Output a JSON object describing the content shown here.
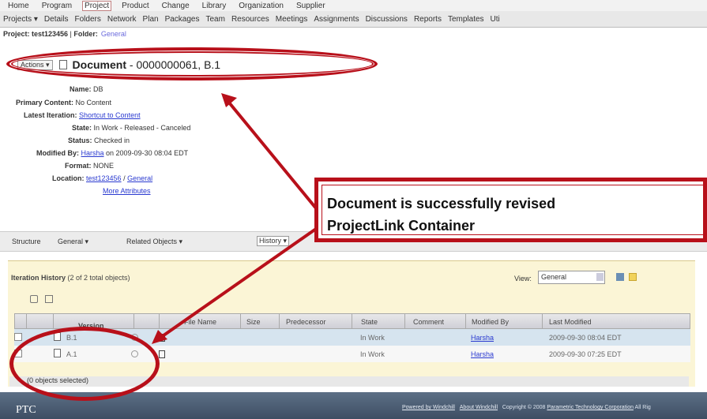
{
  "nav_top": [
    "Home",
    "Program",
    "Project",
    "Product",
    "Change",
    "Library",
    "Organization",
    "Supplier"
  ],
  "nav_top_active": "Project",
  "nav_sub": [
    "Projects ▾",
    "Details",
    "Folders",
    "Network",
    "Plan",
    "Packages",
    "Team",
    "Resources",
    "Meetings",
    "Assignments",
    "Discussions",
    "Reports",
    "Templates",
    "Uti"
  ],
  "breadcrumb": {
    "project": "Project: test123456",
    "sep": " | ",
    "folder_label": "Folder:",
    "folder": "General"
  },
  "header": {
    "actions": "Actions ▾",
    "doc_type": "Document",
    "doc_rest": " - 0000000061, B.1"
  },
  "attributes": {
    "name_label": "Name:",
    "name_value": "DB",
    "primary_label": "Primary Content:",
    "primary_value": "No Content",
    "latest_label": "Latest Iteration:",
    "latest_value": "Shortcut to Content",
    "state_label": "State:",
    "state_value": "In Work - Released - Canceled",
    "status_label": "Status:",
    "status_value": "Checked in",
    "modified_label": "Modified By:",
    "modified_user": "Harsha",
    "modified_rest": " on 2009-09-30 08:04 EDT",
    "format_label": "Format:",
    "format_value": "NONE",
    "location_label": "Location:",
    "location_project": "test123456",
    "location_sep": " / ",
    "location_folder": "General",
    "more": "More Attributes"
  },
  "tabs": [
    "Structure",
    "General ▾",
    "Related Objects ▾"
  ],
  "history_tab": "History ▾",
  "iteration": {
    "title": "Iteration History",
    "count": " (2 of 2 total objects)",
    "view_label": "View:",
    "view_value": "General"
  },
  "table": {
    "columns": [
      "Version",
      "",
      "File Name",
      "Size",
      "Predecessor",
      "State",
      "Comment",
      "Modified By",
      "Last Modified"
    ],
    "sort_indicator": "↓",
    "rows": [
      {
        "version": "B.1",
        "state": "In Work",
        "modified_by": "Harsha",
        "last_modified": "2009-09-30 08:04 EDT"
      },
      {
        "version": "A.1",
        "state": "In Work",
        "modified_by": "Harsha",
        "last_modified": "2009-09-30 07:25 EDT"
      }
    ],
    "selection_status": "(0 objects selected)"
  },
  "callout": {
    "line1": "Document is successfully revised",
    "line2": "ProjectLink Container"
  },
  "footer": {
    "logo": "PTC",
    "powered": "Powered by Windchill",
    "about": "About Windchill",
    "copyright": "Copyright © 2008",
    "company": "Parametric Technology Corporation",
    "rights": "All Rig"
  },
  "colors": {
    "annotation": "#b8101a",
    "link": "#2a3ad0",
    "panel": "#fbf5d6",
    "footer": "#4b5c72"
  }
}
